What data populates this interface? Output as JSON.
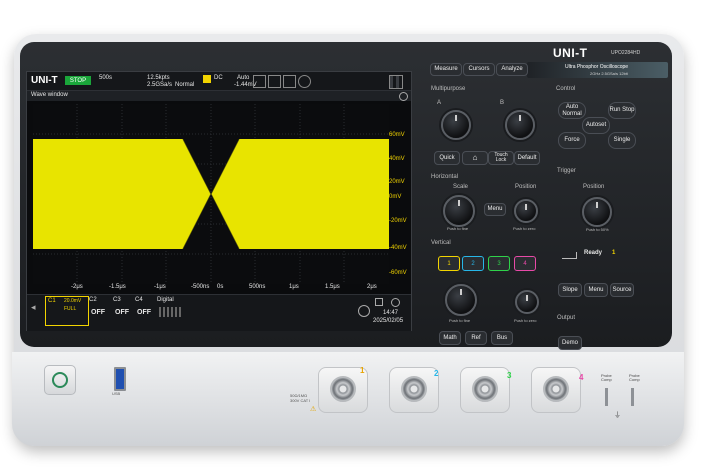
{
  "brand": {
    "logo": "UNI-T",
    "model": "UPO2284HD",
    "subtitle": "Ultra Phosphor Oscilloscope",
    "spec": "2GHz 2.5GSa/s 12bit"
  },
  "screen": {
    "logo": "UNI-T",
    "mode_badge": "STOP",
    "top_bar": [
      "500s",
      "Normal",
      "12.5kpts",
      "2.5GSa/s",
      "DC",
      "Auto",
      "-1.44mV"
    ],
    "window_title": "Wave window",
    "y_labels": [
      "60mV",
      "40mV",
      "20mV",
      "0mV",
      "-20mV",
      "-40mV",
      "-60mV"
    ],
    "x_labels": [
      "-2μs",
      "-1.5μs",
      "-1μs",
      "-500ns",
      "0s",
      "500ns",
      "1μs",
      "1.5μs",
      "2μs"
    ],
    "channels": [
      {
        "name": "C1",
        "state": "20.0mV",
        "extra": "FULL"
      },
      {
        "name": "C2",
        "state": "OFF"
      },
      {
        "name": "C3",
        "state": "OFF"
      },
      {
        "name": "C4",
        "state": "OFF"
      },
      {
        "name": "Digital",
        "state": ""
      }
    ],
    "time": "14:47",
    "date": "2025/02/05"
  },
  "top_buttons": [
    "Measure",
    "Cursors",
    "Analyze"
  ],
  "multipurpose": {
    "label": "Multipurpose",
    "knob_a": "A",
    "knob_b": "B",
    "buttons": [
      "Quick",
      "Touch Lock",
      "Default"
    ]
  },
  "control": {
    "label": "Control",
    "buttons": [
      "Auto Normal",
      "Run Stop",
      "Autoset",
      "Force",
      "Single"
    ]
  },
  "horizontal": {
    "label": "Horizontal",
    "scale": "Scale",
    "position": "Position",
    "menu": "Menu",
    "push_fine": "Push to fine",
    "push_zero": "Push to zero"
  },
  "trigger": {
    "label": "Trigger",
    "position": "Position",
    "ready": "Ready",
    "level": "1",
    "buttons": [
      "Slope",
      "Menu",
      "Source"
    ],
    "push_zero": "Push to 50%"
  },
  "vertical": {
    "label": "Vertical",
    "channels": [
      "1",
      "2",
      "3",
      "4"
    ],
    "channel_colors": [
      "#f2d400",
      "#27b6e8",
      "#2fd24a",
      "#e84aa8"
    ],
    "buttons": [
      "Math",
      "Ref",
      "Bus"
    ],
    "push_fine": "Push to fine",
    "push_zero": "Push to zero"
  },
  "output": {
    "label": "Output",
    "demo": "Demo"
  },
  "front": {
    "bnc_numbers": [
      "1",
      "2",
      "3",
      "4"
    ],
    "probe_comp": "Probe Comp",
    "usb": "USB",
    "rating": "50Ω/1MΩ 300V CAT I"
  }
}
